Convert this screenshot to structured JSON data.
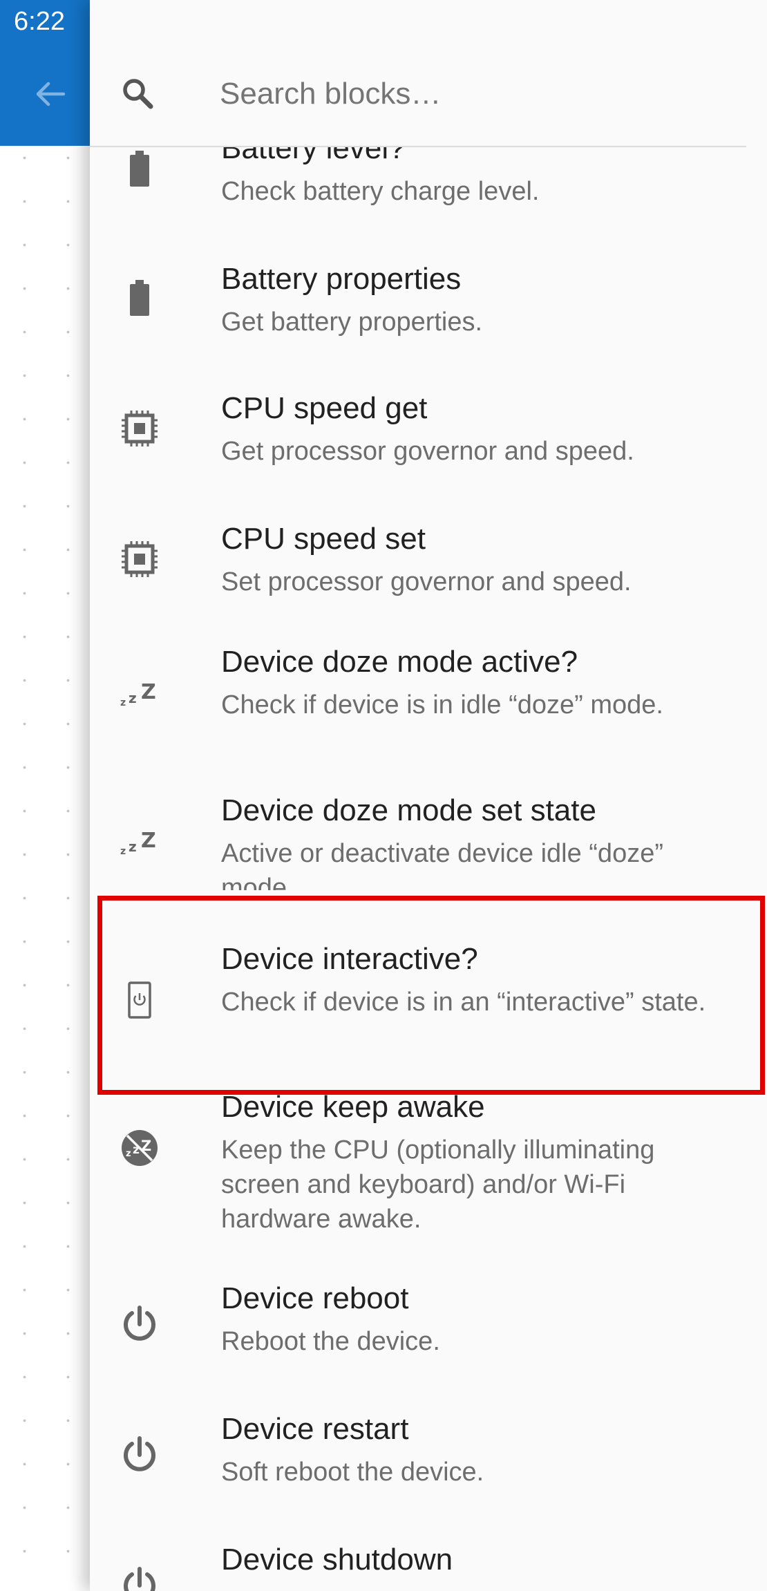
{
  "status_bar": {
    "time": "6:22"
  },
  "search": {
    "placeholder": "Search blocks…",
    "value": ""
  },
  "colors": {
    "appbar": "#1473c6",
    "highlight": "#e00000",
    "icon": "#666666"
  },
  "blocks": [
    {
      "title": "Battery level?",
      "description": "Check battery charge level.",
      "icon": "battery-icon"
    },
    {
      "title": "Battery properties",
      "description": "Get battery properties.",
      "icon": "battery-icon"
    },
    {
      "title": "CPU speed get",
      "description": "Get processor governor and speed.",
      "icon": "chip-icon"
    },
    {
      "title": "CPU speed set",
      "description": "Set processor governor and speed.",
      "icon": "chip-icon"
    },
    {
      "title": "Device doze mode active?",
      "description": "Check if device is in idle “doze” mode.",
      "icon": "sleep-icon"
    },
    {
      "title": "Device doze mode set state",
      "description": "Active or deactivate device idle “doze” mode.",
      "icon": "sleep-icon"
    },
    {
      "title": "Device interactive?",
      "description": "Check if device is in an “interactive” state.",
      "icon": "device-power-icon",
      "highlighted": true
    },
    {
      "title": "Device keep awake",
      "description": "Keep the CPU (optionally illuminating screen and keyboard) and/or Wi-Fi hardware awake.",
      "icon": "no-sleep-icon"
    },
    {
      "title": "Device reboot",
      "description": "Reboot the device.",
      "icon": "power-icon"
    },
    {
      "title": "Device restart",
      "description": "Soft reboot the device.",
      "icon": "power-icon"
    },
    {
      "title": "Device shutdown",
      "description": "",
      "icon": "power-icon"
    }
  ]
}
